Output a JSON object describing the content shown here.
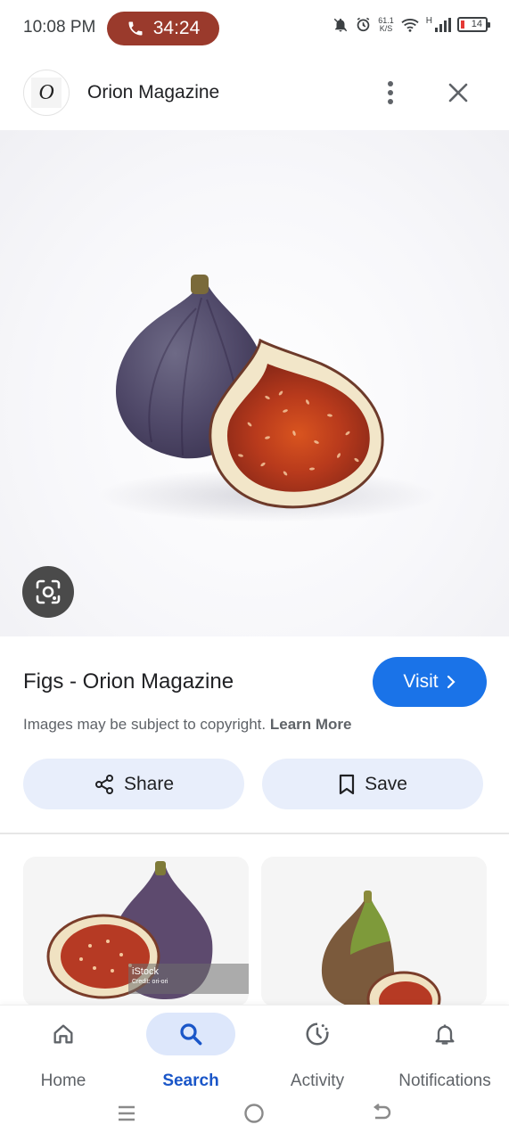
{
  "status_bar": {
    "time": "10:08 PM",
    "call_timer": "34:24",
    "net_speed_value": "61.1",
    "net_speed_unit": "K/S",
    "network_type": "H",
    "battery_level": "14",
    "icons": [
      "phone-icon",
      "mute-icon",
      "alarm-icon",
      "wifi-icon",
      "signal-icon",
      "battery-icon"
    ]
  },
  "header": {
    "site_logo_letter": "O",
    "site_name": "Orion Magazine"
  },
  "image": {
    "subject": "figs"
  },
  "details": {
    "title": "Figs - Orion Magazine",
    "visit_label": "Visit",
    "copyright_text": "Images may be subject to copyright.",
    "learn_more_label": "Learn More"
  },
  "actions": {
    "share_label": "Share",
    "save_label": "Save"
  },
  "related": {
    "watermark_brand": "iStock",
    "watermark_credit": "Credit: ori-ori"
  },
  "bottom_nav": {
    "items": [
      {
        "label": "Home",
        "icon": "home-icon"
      },
      {
        "label": "Search",
        "icon": "search-icon",
        "selected": true
      },
      {
        "label": "Activity",
        "icon": "activity-icon"
      },
      {
        "label": "Notifications",
        "icon": "bell-icon"
      }
    ]
  },
  "colors": {
    "accent": "#1a73e8",
    "call_pill": "#9a3a2c",
    "action_button_bg": "#e8eefb",
    "selected_nav_bg": "#dde7fb"
  }
}
